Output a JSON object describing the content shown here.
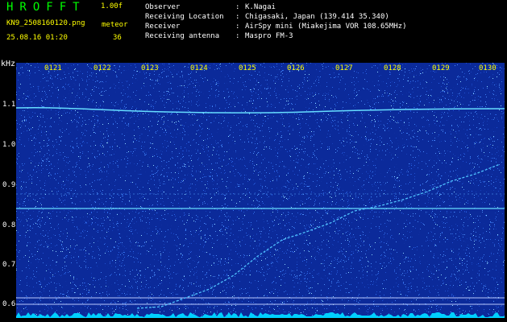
{
  "header": {
    "app_title": "HROFFT",
    "version": "1.00f",
    "filename": "KN9_2508160120.png",
    "meteor_label": "meteor",
    "timestamp": "25.08.16 01:20",
    "meteor_count": "36"
  },
  "info": [
    {
      "key": "Observer",
      "sep": ":",
      "value": "K.Nagai"
    },
    {
      "key": "Receiving Location",
      "sep": ":",
      "value": "Chigasaki, Japan (139.414 35.340)"
    },
    {
      "key": "Receiver",
      "sep": ":",
      "value": "AirSpy mini (Miakejima VOR 108.65MHz)"
    },
    {
      "key": "Receiving antenna",
      "sep": ":",
      "value": "Maspro FM-3"
    }
  ],
  "axis": {
    "y_unit": "kHz",
    "y_ticks": [
      "1.1",
      "1.0",
      "0.9",
      "0.8",
      "0.7",
      "0.6"
    ],
    "x_ticks": [
      "0121",
      "0122",
      "0123",
      "0124",
      "0125",
      "0126",
      "0127",
      "0128",
      "0129",
      "0130"
    ]
  },
  "colors": {
    "background": "#000000",
    "waterfall_noise": "#0b2a9a",
    "signal": "#66ddff",
    "title_green": "#00ff00",
    "label_yellow": "#ffff00"
  }
}
